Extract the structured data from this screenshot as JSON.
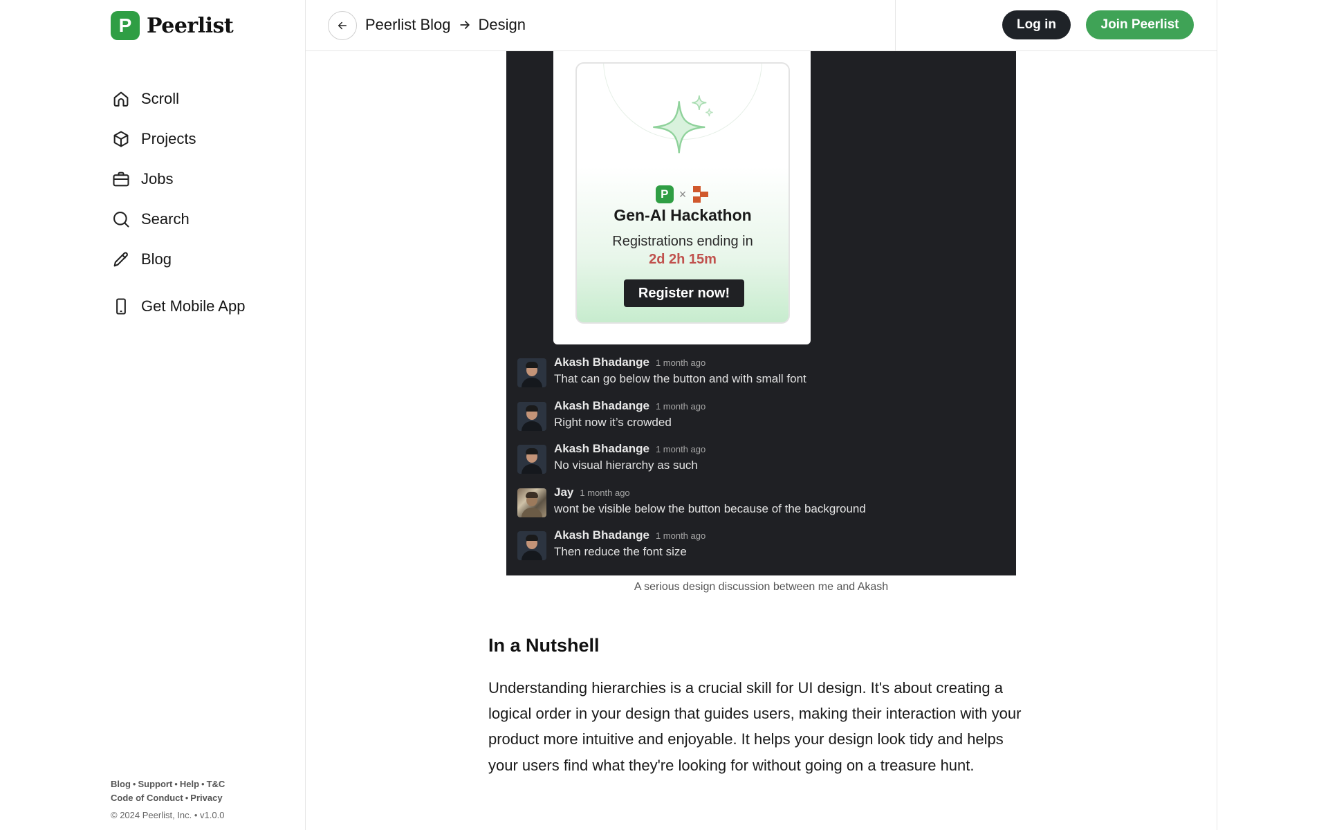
{
  "brand": {
    "name": "Peerlist",
    "mark": "P"
  },
  "sidebar": {
    "items": [
      {
        "label": "Scroll",
        "icon": "home-icon"
      },
      {
        "label": "Projects",
        "icon": "cube-icon"
      },
      {
        "label": "Jobs",
        "icon": "briefcase-icon"
      },
      {
        "label": "Search",
        "icon": "search-icon"
      },
      {
        "label": "Blog",
        "icon": "pencil-icon"
      },
      {
        "label": "Get Mobile App",
        "icon": "mobile-phone-icon"
      }
    ]
  },
  "footer": {
    "links_row1": [
      "Blog",
      "Support",
      "Help",
      "T&C"
    ],
    "links_row2": [
      "Code of Conduct",
      "Privacy"
    ],
    "separator": "•",
    "copyright": "© 2024 Peerlist, Inc. • v1.0.0"
  },
  "header": {
    "breadcrumb": [
      "Peerlist Blog",
      "Design"
    ],
    "login_label": "Log in",
    "join_label": "Join Peerlist"
  },
  "article": {
    "card": {
      "brand_mark": "P",
      "times": "×",
      "title": "Gen-AI Hackathon",
      "subtitle": "Registrations ending in",
      "countdown": "2d 2h 15m",
      "button": "Register now!"
    },
    "comments": [
      {
        "name": "Akash Bhadange",
        "time": "1 month ago",
        "text": "That can go below the button and with small font",
        "avatar": "avatar-akash"
      },
      {
        "name": "Akash Bhadange",
        "time": "1 month ago",
        "text": "Right now it’s crowded",
        "avatar": "avatar-akash"
      },
      {
        "name": "Akash Bhadange",
        "time": "1 month ago",
        "text": "No visual hierarchy as such",
        "avatar": "avatar-akash"
      },
      {
        "name": "Jay",
        "time": "1 month ago",
        "text": "wont be visible below the button because of the background",
        "avatar": "avatar-jay"
      },
      {
        "name": "Akash Bhadange",
        "time": "1 month ago",
        "text": "Then reduce the font size",
        "avatar": "avatar-akash"
      }
    ],
    "caption": "A serious design discussion between me and Akash",
    "heading": "In a Nutshell",
    "paragraph": "Understanding hierarchies is a crucial skill for UI design. It's about creating a logical order in your design that guides users, making their interaction with your product more intuitive and enjoyable. It helps your design look tidy and helps your users find what they're looking for without going on a treasure hunt."
  },
  "colors": {
    "brand_green": "#2f9e44",
    "join_button": "#3fa356",
    "login_button": "#1f2328",
    "screenshot_bg": "#1f2024",
    "countdown_red": "#c0514d"
  }
}
